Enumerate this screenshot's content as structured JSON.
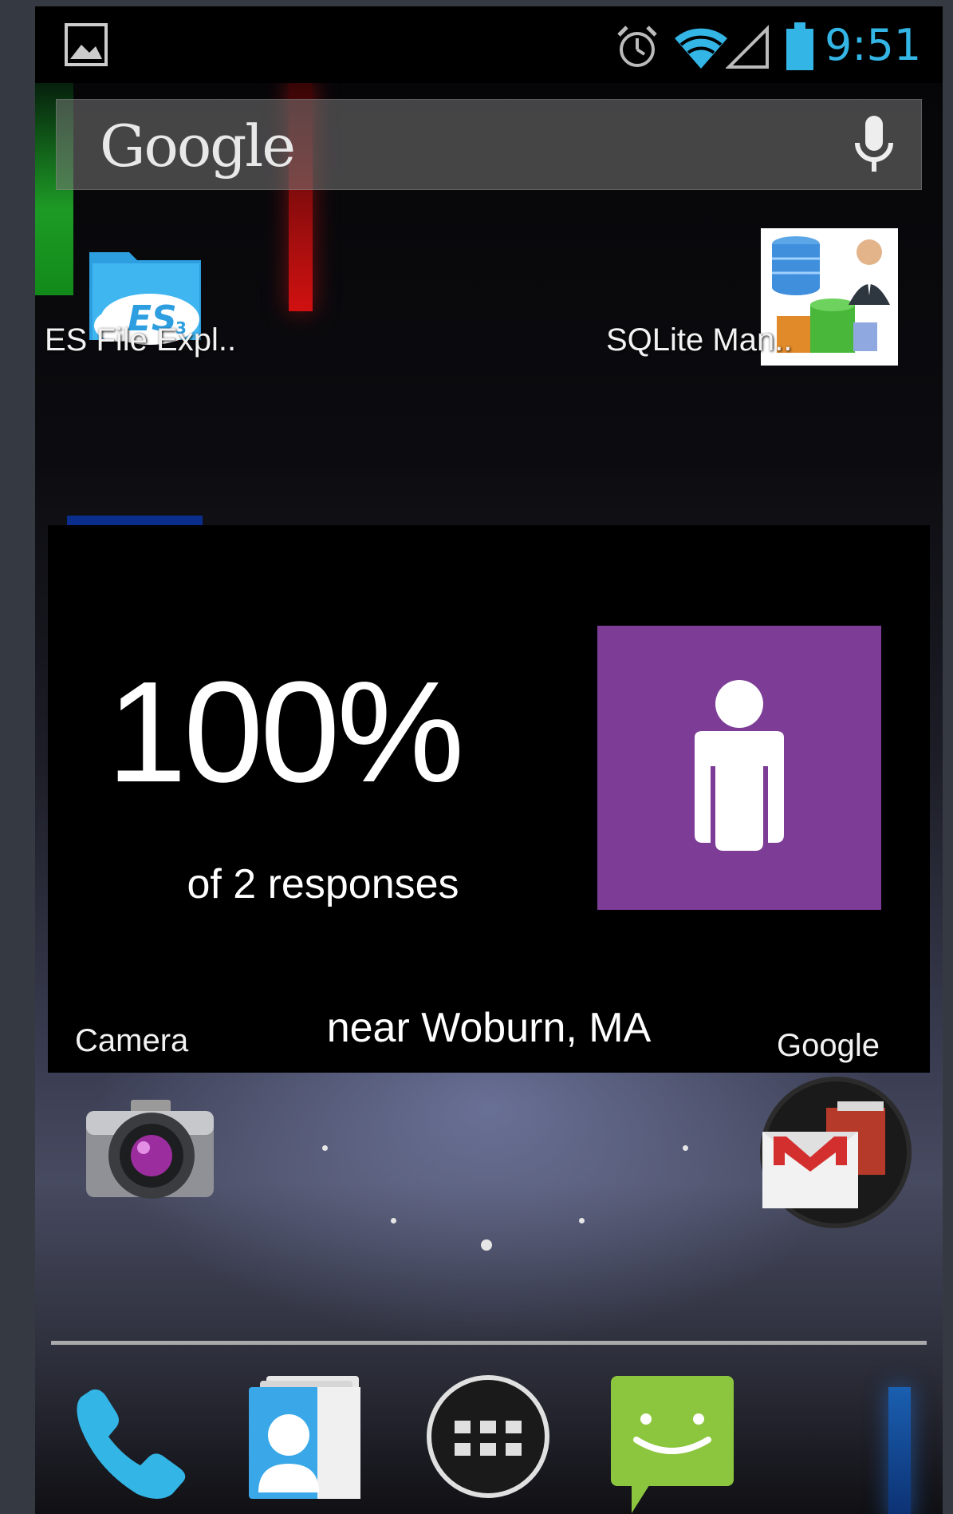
{
  "status_bar": {
    "time": "9:51",
    "icons": [
      "gallery-icon",
      "alarm-icon",
      "wifi-icon",
      "signal-icon",
      "battery-icon"
    ],
    "clock_color": "#33b5e5"
  },
  "search": {
    "logo_text": "Google",
    "icons": [
      "mic-icon"
    ]
  },
  "home_apps": [
    {
      "label": "ES File Expl..",
      "icon": "es-file-explorer-icon"
    },
    {
      "label": "SQLite Man..",
      "icon": "sqlite-manager-icon"
    },
    {
      "label": "Camera",
      "icon": "camera-icon"
    },
    {
      "label": "Google",
      "icon": "gmail-icon"
    }
  ],
  "widget": {
    "percent": "100%",
    "responses": "of 2 responses",
    "location": "near Woburn, MA",
    "tile_color": "#7d3d97",
    "icon": "person-icon"
  },
  "dock": {
    "items": [
      "phone-icon",
      "contacts-icon",
      "app-drawer-icon",
      "messaging-icon"
    ]
  }
}
